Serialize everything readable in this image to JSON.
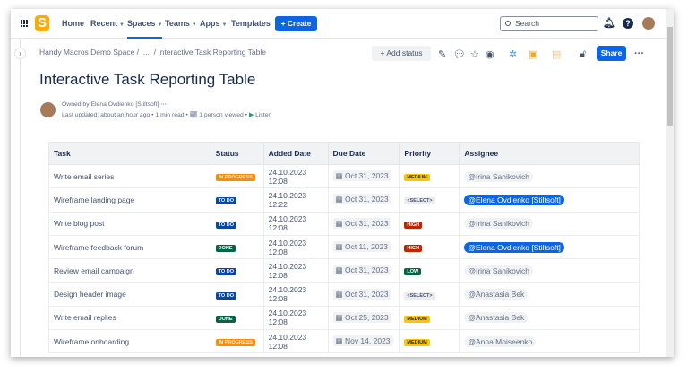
{
  "nav": {
    "items": [
      {
        "label": "Home"
      },
      {
        "label": "Recent",
        "dropdown": true
      },
      {
        "label": "Spaces",
        "dropdown": true,
        "active": true
      },
      {
        "label": "Teams",
        "dropdown": true
      },
      {
        "label": "Apps",
        "dropdown": true
      },
      {
        "label": "Templates"
      }
    ],
    "create_label": "Create",
    "search_placeholder": "Search"
  },
  "breadcrumb": {
    "space": "Handy Macros Demo Space",
    "sep": "/",
    "ellipsis": "...",
    "page": "Interactive Task Reporting Table"
  },
  "toolbar": {
    "add_status": "Add status",
    "share": "Share"
  },
  "page": {
    "title": "Interactive Task Reporting Table",
    "owner": "Owned by Elena Ovdienko [Stiltsoft]",
    "last_updated": "Last updated: about an hour ago",
    "read_time": "1 min read",
    "viewed": "1 person viewed",
    "listen": "Listen"
  },
  "table": {
    "headers": [
      "Task",
      "Status",
      "Added Date",
      "Due Date",
      "Priority",
      "Assignee"
    ],
    "rows": [
      {
        "task": "Write email series",
        "status": "IN PROGRESS",
        "added": "24.10.2023 12:08",
        "due": "Oct 31, 2023",
        "priority": "MEDIUM",
        "assignee": "@Irina Sanikovich",
        "me": false
      },
      {
        "task": "Wireframe landing page",
        "status": "TO DO",
        "added": "24.10.2023 12:22",
        "due": "Oct 31, 2023",
        "priority": "<SELECT>",
        "assignee": "@Elena Ovdienko [Stiltsoft]",
        "me": true
      },
      {
        "task": "Write blog post",
        "status": "TO DO",
        "added": "24.10.2023 12:08",
        "due": "Oct 31, 2023",
        "priority": "HIGH",
        "assignee": "@Irina Sanikovich",
        "me": false
      },
      {
        "task": "Wireframe feedback forum",
        "status": "DONE",
        "added": "24.10.2023 12:08",
        "due": "Oct 11, 2023",
        "priority": "HIGH",
        "assignee": "@Elena Ovdienko [Stiltsoft]",
        "me": true
      },
      {
        "task": "Review email campaign",
        "status": "TO DO",
        "added": "24.10.2023 12:08",
        "due": "Oct 31, 2023",
        "priority": "LOW",
        "assignee": "@Irina Sanikovich",
        "me": false
      },
      {
        "task": "Design header image",
        "status": "TO DO",
        "added": "24.10.2023 12:08",
        "due": "Oct 31, 2023",
        "priority": "<SELECT>",
        "assignee": "@Anastasia Bek",
        "me": false
      },
      {
        "task": "Write email replies",
        "status": "DONE",
        "added": "24.10.2023 12:08",
        "due": "Oct 25, 2023",
        "priority": "MEDIUM",
        "assignee": "@Anastasia Bek",
        "me": false
      },
      {
        "task": "Wireframe onboarding",
        "status": "IN PROGRESS",
        "added": "24.10.2023 12:08",
        "due": "Nov 14, 2023",
        "priority": "MEDIUM",
        "assignee": "@Anna Moiseenko",
        "me": false
      }
    ]
  },
  "colors": {
    "IN PROGRESS": "#ff8b00",
    "TO DO": "#0747a6",
    "DONE": "#006644",
    "MEDIUM": "#ffc400",
    "HIGH": "#bf2600",
    "LOW": "#006644",
    "<SELECT>": "#ebecf0",
    "accent": "#0c66e4"
  }
}
